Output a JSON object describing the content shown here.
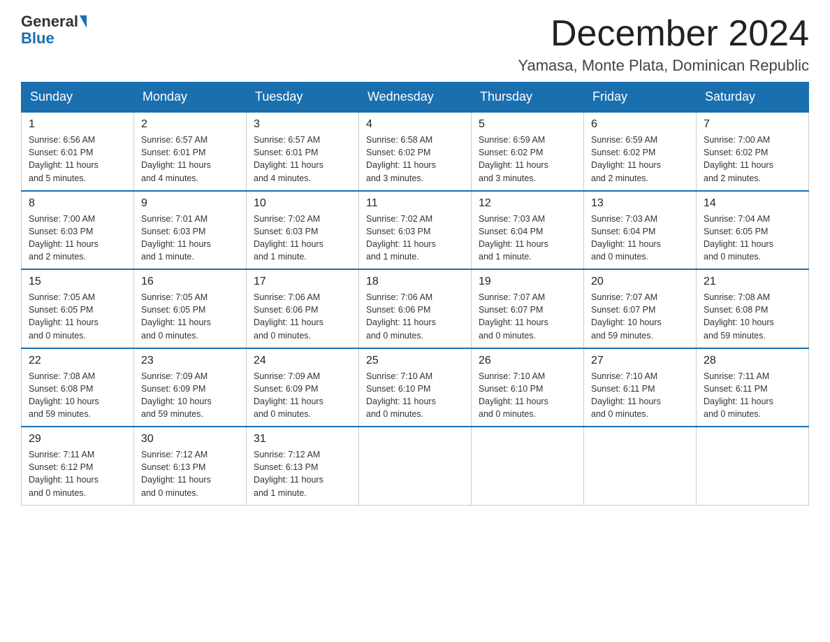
{
  "header": {
    "logo_general": "General",
    "logo_blue": "Blue",
    "month_title": "December 2024",
    "location": "Yamasa, Monte Plata, Dominican Republic"
  },
  "weekdays": [
    "Sunday",
    "Monday",
    "Tuesday",
    "Wednesday",
    "Thursday",
    "Friday",
    "Saturday"
  ],
  "weeks": [
    [
      {
        "day": "1",
        "info": "Sunrise: 6:56 AM\nSunset: 6:01 PM\nDaylight: 11 hours\nand 5 minutes."
      },
      {
        "day": "2",
        "info": "Sunrise: 6:57 AM\nSunset: 6:01 PM\nDaylight: 11 hours\nand 4 minutes."
      },
      {
        "day": "3",
        "info": "Sunrise: 6:57 AM\nSunset: 6:01 PM\nDaylight: 11 hours\nand 4 minutes."
      },
      {
        "day": "4",
        "info": "Sunrise: 6:58 AM\nSunset: 6:02 PM\nDaylight: 11 hours\nand 3 minutes."
      },
      {
        "day": "5",
        "info": "Sunrise: 6:59 AM\nSunset: 6:02 PM\nDaylight: 11 hours\nand 3 minutes."
      },
      {
        "day": "6",
        "info": "Sunrise: 6:59 AM\nSunset: 6:02 PM\nDaylight: 11 hours\nand 2 minutes."
      },
      {
        "day": "7",
        "info": "Sunrise: 7:00 AM\nSunset: 6:02 PM\nDaylight: 11 hours\nand 2 minutes."
      }
    ],
    [
      {
        "day": "8",
        "info": "Sunrise: 7:00 AM\nSunset: 6:03 PM\nDaylight: 11 hours\nand 2 minutes."
      },
      {
        "day": "9",
        "info": "Sunrise: 7:01 AM\nSunset: 6:03 PM\nDaylight: 11 hours\nand 1 minute."
      },
      {
        "day": "10",
        "info": "Sunrise: 7:02 AM\nSunset: 6:03 PM\nDaylight: 11 hours\nand 1 minute."
      },
      {
        "day": "11",
        "info": "Sunrise: 7:02 AM\nSunset: 6:03 PM\nDaylight: 11 hours\nand 1 minute."
      },
      {
        "day": "12",
        "info": "Sunrise: 7:03 AM\nSunset: 6:04 PM\nDaylight: 11 hours\nand 1 minute."
      },
      {
        "day": "13",
        "info": "Sunrise: 7:03 AM\nSunset: 6:04 PM\nDaylight: 11 hours\nand 0 minutes."
      },
      {
        "day": "14",
        "info": "Sunrise: 7:04 AM\nSunset: 6:05 PM\nDaylight: 11 hours\nand 0 minutes."
      }
    ],
    [
      {
        "day": "15",
        "info": "Sunrise: 7:05 AM\nSunset: 6:05 PM\nDaylight: 11 hours\nand 0 minutes."
      },
      {
        "day": "16",
        "info": "Sunrise: 7:05 AM\nSunset: 6:05 PM\nDaylight: 11 hours\nand 0 minutes."
      },
      {
        "day": "17",
        "info": "Sunrise: 7:06 AM\nSunset: 6:06 PM\nDaylight: 11 hours\nand 0 minutes."
      },
      {
        "day": "18",
        "info": "Sunrise: 7:06 AM\nSunset: 6:06 PM\nDaylight: 11 hours\nand 0 minutes."
      },
      {
        "day": "19",
        "info": "Sunrise: 7:07 AM\nSunset: 6:07 PM\nDaylight: 11 hours\nand 0 minutes."
      },
      {
        "day": "20",
        "info": "Sunrise: 7:07 AM\nSunset: 6:07 PM\nDaylight: 10 hours\nand 59 minutes."
      },
      {
        "day": "21",
        "info": "Sunrise: 7:08 AM\nSunset: 6:08 PM\nDaylight: 10 hours\nand 59 minutes."
      }
    ],
    [
      {
        "day": "22",
        "info": "Sunrise: 7:08 AM\nSunset: 6:08 PM\nDaylight: 10 hours\nand 59 minutes."
      },
      {
        "day": "23",
        "info": "Sunrise: 7:09 AM\nSunset: 6:09 PM\nDaylight: 10 hours\nand 59 minutes."
      },
      {
        "day": "24",
        "info": "Sunrise: 7:09 AM\nSunset: 6:09 PM\nDaylight: 11 hours\nand 0 minutes."
      },
      {
        "day": "25",
        "info": "Sunrise: 7:10 AM\nSunset: 6:10 PM\nDaylight: 11 hours\nand 0 minutes."
      },
      {
        "day": "26",
        "info": "Sunrise: 7:10 AM\nSunset: 6:10 PM\nDaylight: 11 hours\nand 0 minutes."
      },
      {
        "day": "27",
        "info": "Sunrise: 7:10 AM\nSunset: 6:11 PM\nDaylight: 11 hours\nand 0 minutes."
      },
      {
        "day": "28",
        "info": "Sunrise: 7:11 AM\nSunset: 6:11 PM\nDaylight: 11 hours\nand 0 minutes."
      }
    ],
    [
      {
        "day": "29",
        "info": "Sunrise: 7:11 AM\nSunset: 6:12 PM\nDaylight: 11 hours\nand 0 minutes."
      },
      {
        "day": "30",
        "info": "Sunrise: 7:12 AM\nSunset: 6:13 PM\nDaylight: 11 hours\nand 0 minutes."
      },
      {
        "day": "31",
        "info": "Sunrise: 7:12 AM\nSunset: 6:13 PM\nDaylight: 11 hours\nand 1 minute."
      },
      null,
      null,
      null,
      null
    ]
  ]
}
